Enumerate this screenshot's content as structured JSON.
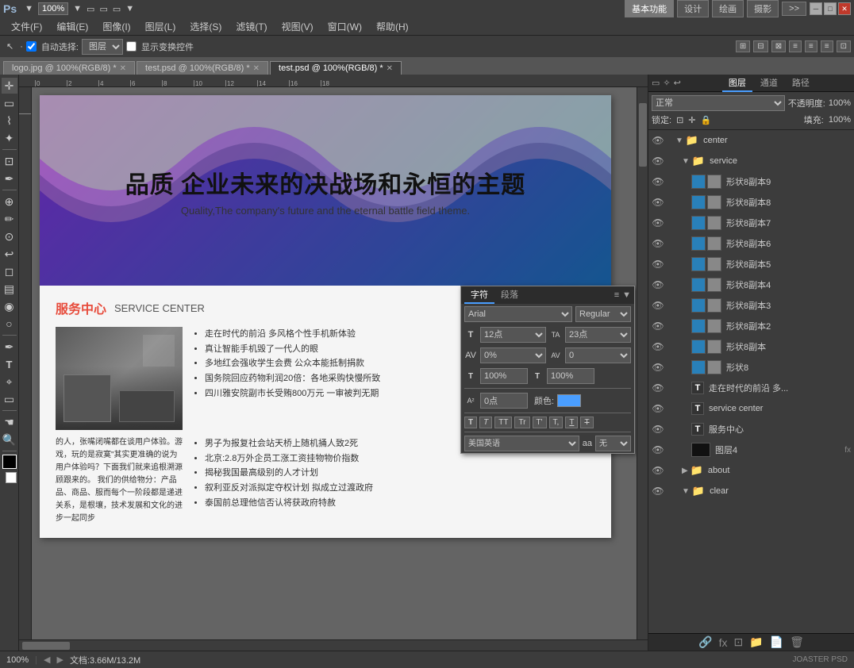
{
  "app": {
    "title": "Adobe Photoshop",
    "logo": "Ps",
    "zoom": "100%",
    "mode_buttons": [
      "基本功能",
      "设计",
      "绘画",
      "摄影",
      ">>"
    ],
    "active_mode": "基本功能"
  },
  "menu": {
    "items": [
      "文件(F)",
      "编辑(E)",
      "图像(I)",
      "图层(L)",
      "选择(S)",
      "滤镜(T)",
      "视图(V)",
      "窗口(W)",
      "帮助(H)"
    ]
  },
  "toolbar": {
    "auto_select_label": "自动选择:",
    "auto_select_checked": true,
    "layer_select": "图层",
    "show_transform_label": "显示变换控件",
    "show_transform_checked": false
  },
  "tabs": [
    {
      "label": "logo.jpg @ 100%(RGB/8) *",
      "active": false
    },
    {
      "label": "test.psd @ 100%(RGB/8) *",
      "active": false
    },
    {
      "label": "test.psd @ 100%(RGB/8) *",
      "active": true
    }
  ],
  "canvas": {
    "design_title_cn": "品质 企业未来的决战场和永恒的主题",
    "design_title_en": "Quality,The company's future and the eternal battle field theme.",
    "service_title_cn": "服务中心",
    "service_title_en": "SERVICE CENTER",
    "service_items": [
      "走在时代的前沿 多风格个性手机新体验",
      "真让智能手机毁了一代人的眼",
      "多地红会强收学生会费 公众本能抵制捐款",
      "国务院回应药物利润20倍：各地采购快慢所致",
      "四川雅安院副市长受贿800万元 一审被判无期",
      "男子为报复社会站天桥上随机捅人致2死",
      "北京:2.8万外企员工涨工资挂物物价指数",
      "揭秘我国最高级别的人才计划",
      "叙利亚反对派拟定夺权计划 拟成立过渡政府",
      "泰国前总理他信否认将获政府特赦"
    ],
    "service_text_right": "的人，张嘴闭嘴都在谈用户体验。游戏，玩的是寂寞\"其实更准确的说为用户体验吗？下面我们就来追根溯源顾跟来的。\n我们的供给物分：产品品、商品、服而每个一阶段都是递进关系，是根壤，技术发展和文化的进步一起同步"
  },
  "character_panel": {
    "tabs": [
      "字符",
      "段落"
    ],
    "active_tab": "字符",
    "font_family": "Arial",
    "font_style": "Regular",
    "font_size": "12点",
    "leading": "23点",
    "tracking_label": "跟踪",
    "tracking_value": "0%",
    "kerning_value": "0",
    "horizontal_scale": "100%",
    "vertical_scale": "100%",
    "baseline": "0点",
    "color_label": "颜色:",
    "color_hex": "#4a9eff",
    "style_buttons": [
      "T",
      "T",
      "TT",
      "Tr",
      "T'",
      "T,",
      "T",
      "T"
    ],
    "language": "美国英语",
    "anti_alias": "无"
  },
  "layers_panel": {
    "tabs": [
      "图层",
      "通道",
      "路径"
    ],
    "active_tab": "图层",
    "blend_mode": "正常",
    "opacity": "100%",
    "lock_label": "锁定:",
    "fill": "100%",
    "layers": [
      {
        "type": "group",
        "name": "center",
        "visible": true,
        "expanded": true,
        "indent": 0
      },
      {
        "type": "group",
        "name": "service",
        "visible": true,
        "expanded": true,
        "indent": 1
      },
      {
        "type": "layer",
        "name": "形状8副本9",
        "visible": true,
        "thumb": "blue-gray",
        "indent": 2
      },
      {
        "type": "layer",
        "name": "形状8副本8",
        "visible": true,
        "thumb": "blue-gray",
        "indent": 2
      },
      {
        "type": "layer",
        "name": "形状8副本7",
        "visible": true,
        "thumb": "blue-gray",
        "indent": 2
      },
      {
        "type": "layer",
        "name": "形状8副本6",
        "visible": true,
        "thumb": "blue-gray",
        "indent": 2
      },
      {
        "type": "layer",
        "name": "形状8副本5",
        "visible": true,
        "thumb": "blue-gray",
        "indent": 2
      },
      {
        "type": "layer",
        "name": "形状8副本4",
        "visible": true,
        "thumb": "blue-gray",
        "indent": 2
      },
      {
        "type": "layer",
        "name": "形状8副本3",
        "visible": true,
        "thumb": "blue-gray",
        "indent": 2
      },
      {
        "type": "layer",
        "name": "形状8副本2",
        "visible": true,
        "thumb": "blue-gray",
        "indent": 2
      },
      {
        "type": "layer",
        "name": "形状8副本",
        "visible": true,
        "thumb": "blue-gray",
        "indent": 2
      },
      {
        "type": "layer",
        "name": "形状8",
        "visible": true,
        "thumb": "blue-gray",
        "indent": 2
      },
      {
        "type": "text",
        "name": "走在时代的前沿 多...",
        "visible": true,
        "indent": 2
      },
      {
        "type": "text",
        "name": "service center",
        "visible": true,
        "indent": 2
      },
      {
        "type": "text",
        "name": "服务中心",
        "visible": true,
        "indent": 2
      },
      {
        "type": "layer",
        "name": "图层4",
        "visible": true,
        "thumb": "dark",
        "indent": 2,
        "has_fx": true
      },
      {
        "type": "group",
        "name": "about",
        "visible": true,
        "expanded": false,
        "indent": 1
      },
      {
        "type": "group",
        "name": "clear",
        "visible": true,
        "expanded": false,
        "indent": 1
      }
    ]
  },
  "status": {
    "zoom": "100%",
    "doc_size": "文档:3.66M/13.2M"
  }
}
